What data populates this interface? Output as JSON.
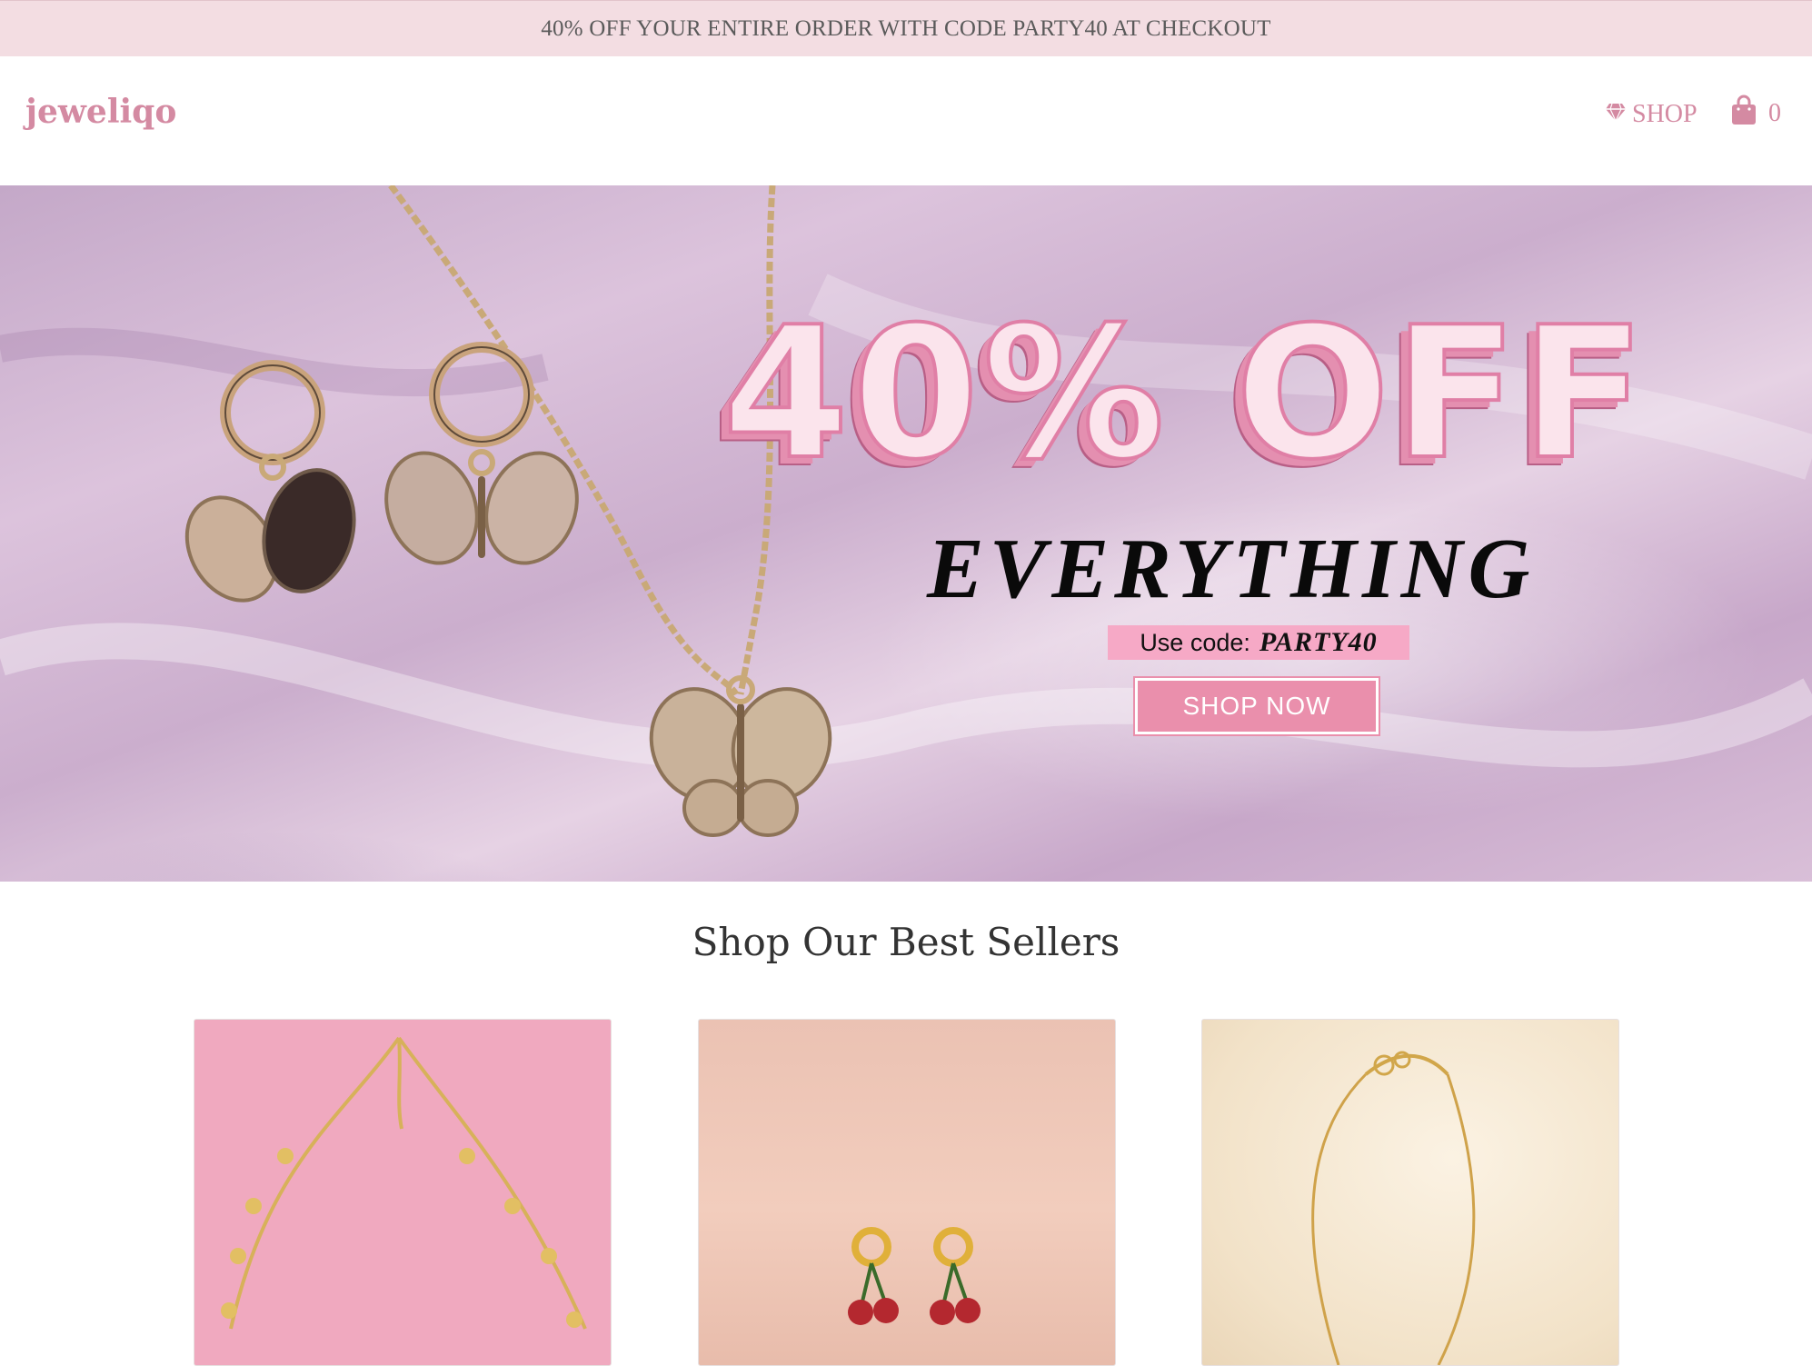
{
  "announcement": "40% OFF YOUR ENTIRE ORDER WITH CODE PARTY40 AT CHECKOUT",
  "header": {
    "logo": "jeweliqo",
    "nav_shop": "SHOP",
    "cart_count": "0"
  },
  "hero": {
    "headline": "40% OFF",
    "subheadline": "EVERYTHING",
    "code_label": "Use code:",
    "code": "PARTY40",
    "cta": "SHOP NOW"
  },
  "best_sellers": {
    "title": "Shop Our Best Sellers"
  },
  "colors": {
    "brand_pink": "#d48aa2",
    "announcement_bg": "#f3dde2",
    "cta_pink": "#ea8fac"
  },
  "icons": [
    "diamond-icon",
    "shopping-bag-icon"
  ]
}
